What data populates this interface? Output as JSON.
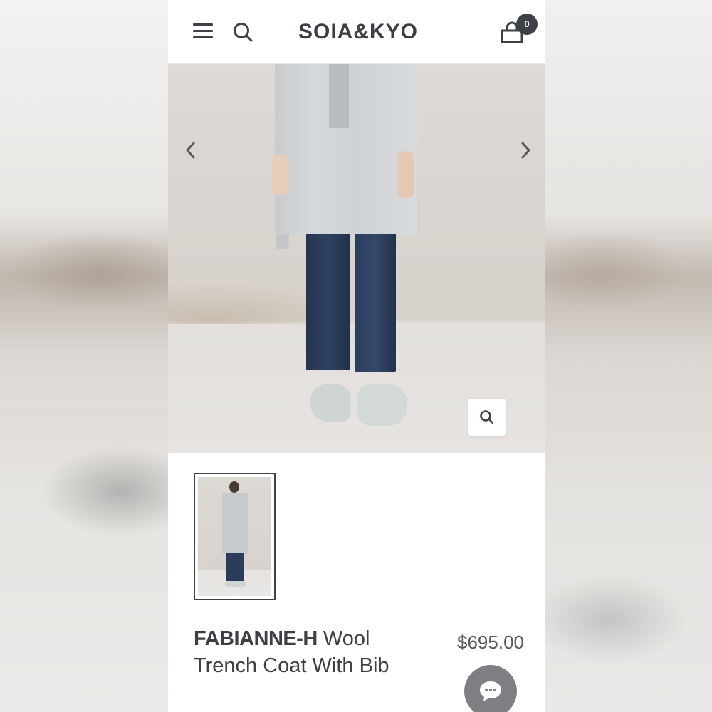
{
  "header": {
    "brand": "SOIA&KYO",
    "cart_count": "0",
    "icons": [
      "menu-icon",
      "search-icon",
      "cart-icon"
    ]
  },
  "gallery": {
    "icons": [
      "chevron-left-icon",
      "chevron-right-icon",
      "zoom-icon"
    ]
  },
  "product": {
    "name": "FABIANNE-H",
    "title_rest": "Wool Trench Coat With Bib",
    "price": "$695.00"
  },
  "chat": {
    "icon": "chat-bubble-icon"
  },
  "colors": {
    "text_dark": "#3c3f44",
    "badge": "#3e4146",
    "chat_button": "#7d7f82"
  }
}
